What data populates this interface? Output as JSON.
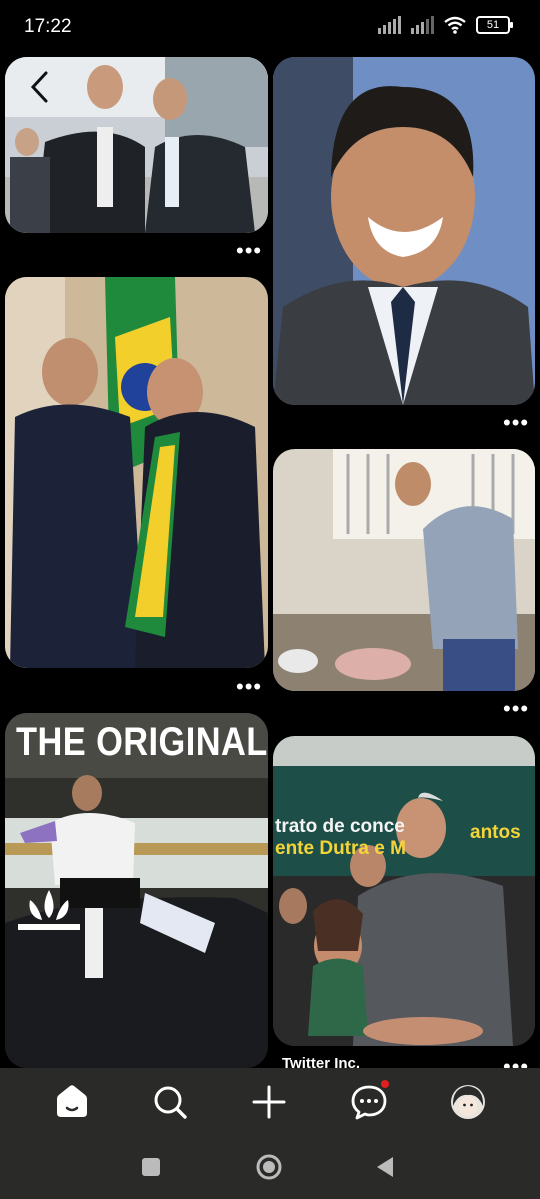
{
  "status": {
    "time": "17:22",
    "battery": "51"
  },
  "icons": {
    "back": "chevron-left-icon",
    "more": "more-horizontal-icon",
    "home": "home-icon",
    "search": "search-icon",
    "create": "plus-icon",
    "messages": "chat-bubble-icon",
    "profile": "avatar",
    "recents": "square-icon",
    "home_sys": "circle-icon",
    "back_sys": "triangle-back-icon"
  },
  "pins": {
    "ad": {
      "headline": "THE ORIGINAL"
    },
    "event": {
      "banner_line1": "trato de conce",
      "banner_line1b": "antos",
      "banner_line2": "ente Dutra e M",
      "caption": "Twitter Inc."
    },
    "more_label": "•••"
  },
  "colors": {
    "background": "#000000",
    "nav_bar": "#2a2a28",
    "notification": "#e02020"
  }
}
